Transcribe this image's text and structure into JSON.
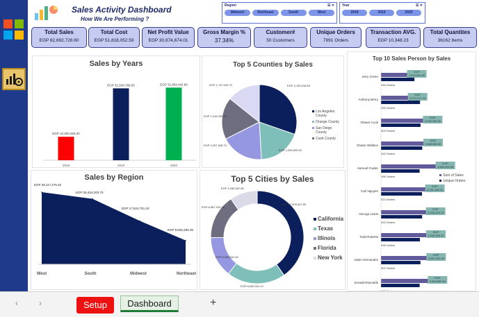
{
  "header": {
    "title": "Sales Activity Dashboard",
    "subtitle": "How We Are Performing ?"
  },
  "slicers": {
    "region": {
      "label": "Region",
      "items": [
        "Midwest",
        "Northeast",
        "South",
        "West"
      ]
    },
    "year": {
      "label": "Year",
      "items": [
        "2018",
        "2019",
        "2020"
      ]
    }
  },
  "kpis": [
    {
      "label": "Total Sales",
      "value": "EGP 82,692,726.60"
    },
    {
      "label": "Total Cost",
      "value": "EGP 51,818,052.59"
    },
    {
      "label": "Net Profit Value",
      "value": "EGP 30,874,674.01"
    },
    {
      "label": "Gross Margin %",
      "value": "37.34%"
    },
    {
      "label": "Customer#",
      "value": "50 Customers"
    },
    {
      "label": "Unique Orders",
      "value": "7991 Orders"
    },
    {
      "label": "Transaction AVG.",
      "value": "EGP 10,348.23"
    },
    {
      "label": "Total Quantites",
      "value": "36162 Items"
    }
  ],
  "colors": {
    "sidebar": "#1f3a8a",
    "kpi_bg": "#c6cbf2",
    "navy": "#0b1f5c",
    "bar_2018": "#ff0000",
    "bar_2019": "#0b1f5c",
    "bar_2020": "#00b050",
    "setup_tab": "#ee1111"
  },
  "tabs": {
    "setup": "Setup",
    "dashboard": "Dashboard",
    "add": "+",
    "prev": "‹",
    "next": "›"
  },
  "chart_data": [
    {
      "id": "sales_by_years",
      "type": "bar",
      "title": "Sales by Years",
      "categories": [
        "2018",
        "2019",
        "2020"
      ],
      "values": [
        10293494.2,
        31534789.5,
        31864442.9
      ],
      "data_labels": [
        "EGP 10,293,494.20",
        "EGP 31,534,789.50",
        "EGP 31,864,442.90"
      ],
      "ylim": [
        0,
        35000000
      ],
      "grid": false
    },
    {
      "id": "top5_counties",
      "type": "pie",
      "title": "Top 5 Counties by Sales",
      "series": [
        {
          "name": "Los Angeles County",
          "value": 3705518.8,
          "label": "EGP 3,705,518.80",
          "color": "#0b1f5c"
        },
        {
          "name": "Orange County",
          "value": 2295600.5,
          "label": "EGP 2,295,600.50",
          "color": "#7fbfb9"
        },
        {
          "name": "San Diego County",
          "value": 2257528.7,
          "label": "EGP 2,257,528.70",
          "color": "#9597e0"
        },
        {
          "name": "Cook County",
          "value": 2216032.0,
          "label": "EGP 2,216,032.00",
          "color": "#6f6d80"
        },
        {
          "name": "",
          "value": 1747049.7,
          "label": "EGP 1,747,049.70",
          "color": "#d9d9f3"
        }
      ],
      "legend": "right"
    },
    {
      "id": "sales_by_region",
      "type": "area",
      "title": "Sales by Region",
      "categories": [
        "West",
        "South",
        "Midwest",
        "Northeast"
      ],
      "values": [
        29117275.4,
        26424203.7,
        17524761.2,
        9626486.3
      ],
      "data_labels": [
        "EGP 29,117,275.40",
        "EGP 26,424,203.70",
        "EGP 17,524,761.20",
        "EGP 9,626,486.30"
      ],
      "ylim": [
        0,
        35000000
      ]
    },
    {
      "id": "top5_cities",
      "type": "pie",
      "subtype": "doughnut",
      "title": "Top 5 Cities by Sales",
      "series": [
        {
          "name": "California",
          "value": 17003447.8,
          "label": "EGP 17,003,447.80",
          "color": "#0b1f5c"
        },
        {
          "name": "Texas",
          "value": 8630041.1,
          "label": "EGP 8,630,041.10",
          "color": "#7fbfb9"
        },
        {
          "name": "Illinois",
          "value": 6008941.5,
          "label": "EGP 6,008,941.50",
          "color": "#9597e0"
        },
        {
          "name": "Florida",
          "value": 6587910.3,
          "label": "EGP 6,587,910.30",
          "color": "#6f6d80"
        },
        {
          "name": "New York",
          "value": 4036087.8,
          "label": "EGP 4,036,087.80",
          "color": "#d9d9e8"
        }
      ],
      "legend": "right"
    },
    {
      "id": "top10_salespersons",
      "type": "bar",
      "orientation": "horizontal",
      "title": "Top 10 Sales Person by Sales",
      "categories": [
        "Jerry Green",
        "Anthony Berry",
        "Shawn Cook",
        "Shawn Wallace",
        "Samuel Fowler",
        "Carl Nguyen",
        "George Lewis",
        "Todd Roberts",
        "Adam Hernandez",
        "Donald Reynolds"
      ],
      "series": [
        {
          "name": "Sum of Sales",
          "values": [
            2023826.4,
            2074217.1,
            3038756.9,
            3065560.5,
            3850999.3,
            3181168.1,
            3228403.7,
            3242525.3,
            3261350.0,
            3348569.6
          ]
        },
        {
          "name": "Unique Orders",
          "values": [
            256,
            299,
            303,
            316,
            296,
            314,
            315,
            298,
            302,
            296
          ]
        }
      ],
      "sales_labels": [
        "EGP 2,023,826.40",
        "EGP 2,074,217.10",
        "EGP 3,038,756.90",
        "EGP 3,065,560.50",
        "EGP 3,850,999.30",
        "EGP 3,181,168.10",
        "EGP 3,228,403.70",
        "EGP 3,242,525.30",
        "EGP 3,261,350.00",
        "EGP 3,348,569.60"
      ],
      "order_labels": [
        "256 Orders",
        "299 Orders",
        "303 Orders",
        "316 Orders",
        "296 Orders",
        "314 Orders",
        "315 Orders",
        "298 Orders",
        "302 Orders",
        "296 Orders"
      ],
      "legend": "right"
    }
  ]
}
